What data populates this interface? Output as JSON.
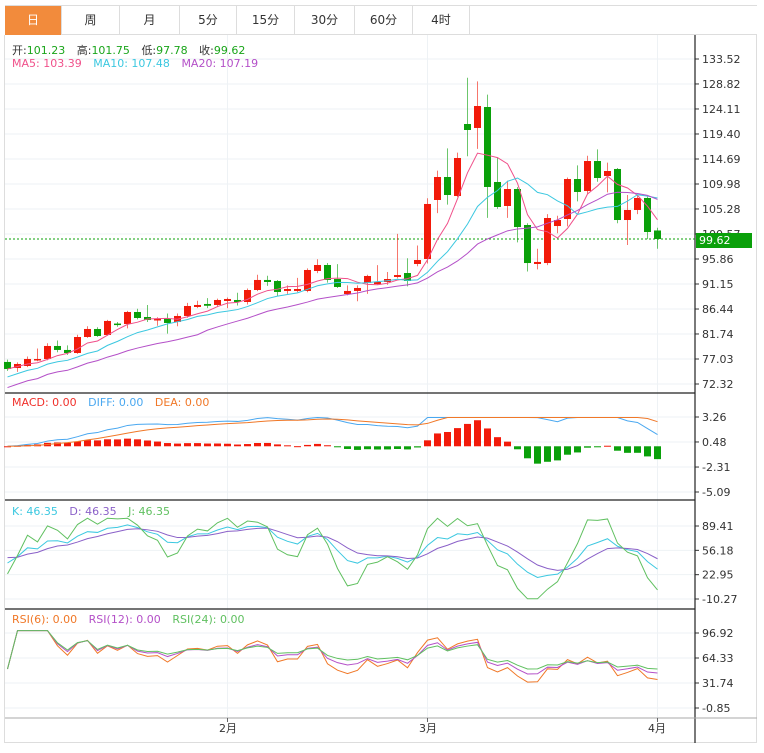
{
  "tabs": [
    {
      "label": "日",
      "active": true
    },
    {
      "label": "周"
    },
    {
      "label": "月"
    },
    {
      "label": "5分"
    },
    {
      "label": "15分"
    },
    {
      "label": "30分"
    },
    {
      "label": "60分"
    },
    {
      "label": "4时"
    }
  ],
  "quote": {
    "open_label": "开:",
    "open": "101.23",
    "high_label": "高:",
    "high": "101.75",
    "low_label": "低:",
    "low": "97.78",
    "close_label": "收:",
    "close": "99.62"
  },
  "ma": {
    "ma5": "MA5: 103.39",
    "ma10": "MA10: 107.48",
    "ma20": "MA20: 107.19"
  },
  "macd_legend": {
    "macd": "MACD: 0.00",
    "diff": "DIFF: 0.00",
    "dea": "DEA: 0.00"
  },
  "kdj_legend": {
    "k": "K: 46.35",
    "d": "D: 46.35",
    "j": "J: 46.35"
  },
  "rsi_legend": {
    "rsi6": "RSI(6): 0.00",
    "rsi12": "RSI(12): 0.00",
    "rsi24": "RSI(24): 0.00"
  },
  "last_price": "99.62",
  "colors": {
    "up": "#f21a0a",
    "down": "#0aa00a",
    "ma5": "#f0508a",
    "ma10": "#3cc8e0",
    "ma20": "#b450c8",
    "diff": "#4aa8f0",
    "dea": "#f07828",
    "accent": "#f28b3c"
  },
  "x_labels": [
    {
      "label": "2月",
      "index": 22
    },
    {
      "label": "3月",
      "index": 42
    },
    {
      "label": "4月",
      "index": 65
    }
  ],
  "chart_data": {
    "type": "candlestick",
    "price_axis": [
      "133.52",
      "128.82",
      "124.11",
      "119.40",
      "114.69",
      "109.98",
      "105.28",
      "100.57",
      "95.86",
      "91.15",
      "86.44",
      "81.74",
      "77.03",
      "72.32"
    ],
    "macd_axis": [
      "3.26",
      "0.48",
      "-2.31",
      "-5.09"
    ],
    "kdj_axis": [
      "89.41",
      "56.18",
      "22.95",
      "-10.27"
    ],
    "rsi_axis": [
      "96.92",
      "64.33",
      "31.74",
      "-0.85"
    ],
    "ohlc": [
      [
        76.47,
        76.9,
        74.8,
        75.15
      ],
      [
        75.33,
        76.4,
        74.6,
        76.09
      ],
      [
        75.71,
        77.5,
        75.5,
        77.03
      ],
      [
        76.95,
        79.0,
        76.6,
        77.03
      ],
      [
        77.03,
        80.0,
        76.8,
        79.48
      ],
      [
        79.48,
        80.5,
        78.3,
        78.73
      ],
      [
        78.73,
        79.6,
        77.8,
        78.16
      ],
      [
        78.16,
        81.6,
        78.0,
        81.17
      ],
      [
        81.17,
        83.2,
        81.0,
        82.68
      ],
      [
        82.68,
        83.0,
        81.2,
        81.36
      ],
      [
        81.55,
        84.4,
        81.4,
        84.19
      ],
      [
        83.7,
        84.0,
        83.1,
        83.62
      ],
      [
        83.62,
        86.1,
        82.8,
        85.88
      ],
      [
        85.88,
        86.5,
        84.5,
        84.75
      ],
      [
        84.94,
        87.2,
        84.0,
        84.37
      ],
      [
        84.37,
        84.9,
        83.3,
        84.56
      ],
      [
        84.56,
        85.6,
        81.8,
        83.81
      ],
      [
        84.0,
        85.6,
        83.2,
        85.13
      ],
      [
        85.13,
        87.6,
        84.8,
        87.01
      ],
      [
        86.82,
        88.0,
        86.6,
        87.2
      ],
      [
        87.39,
        88.5,
        86.6,
        87.05
      ],
      [
        87.2,
        88.4,
        86.8,
        88.14
      ],
      [
        87.95,
        88.6,
        86.6,
        88.33
      ],
      [
        88.14,
        89.5,
        87.1,
        87.76
      ],
      [
        87.76,
        90.3,
        87.3,
        90.02
      ],
      [
        90.02,
        92.9,
        89.8,
        91.91
      ],
      [
        91.91,
        92.7,
        90.8,
        91.53
      ],
      [
        91.72,
        91.9,
        88.8,
        89.65
      ],
      [
        89.84,
        90.9,
        89.3,
        90.21
      ],
      [
        89.84,
        92.3,
        89.6,
        90.21
      ],
      [
        89.84,
        94.1,
        89.6,
        93.79
      ],
      [
        93.6,
        95.8,
        93.2,
        94.73
      ],
      [
        94.73,
        95.1,
        91.4,
        91.91
      ],
      [
        92.09,
        94.9,
        90.4,
        90.59
      ],
      [
        89.27,
        90.9,
        89.0,
        89.84
      ],
      [
        89.84,
        90.9,
        87.9,
        90.4
      ],
      [
        91.34,
        92.9,
        89.3,
        92.66
      ],
      [
        91.15,
        94.7,
        91.0,
        91.53
      ],
      [
        91.53,
        93.4,
        91.0,
        92.09
      ],
      [
        92.47,
        100.6,
        92.2,
        92.84
      ],
      [
        93.22,
        96.0,
        90.7,
        91.72
      ],
      [
        94.92,
        98.4,
        94.5,
        95.67
      ],
      [
        95.86,
        107.3,
        95.0,
        106.22
      ],
      [
        106.97,
        112.5,
        104.5,
        111.3
      ],
      [
        111.3,
        116.7,
        106.1,
        107.91
      ],
      [
        107.72,
        115.9,
        107.5,
        114.88
      ],
      [
        121.28,
        130.0,
        115.2,
        120.15
      ],
      [
        120.53,
        129.3,
        116.6,
        124.67
      ],
      [
        124.48,
        126.8,
        103.6,
        109.42
      ],
      [
        110.36,
        115.0,
        105.3,
        105.65
      ],
      [
        105.84,
        110.6,
        103.6,
        109.04
      ],
      [
        109.04,
        109.4,
        99.0,
        101.88
      ],
      [
        102.26,
        102.6,
        93.5,
        95.1
      ],
      [
        94.92,
        97.8,
        93.9,
        95.3
      ],
      [
        95.1,
        104.3,
        94.7,
        103.58
      ],
      [
        102.07,
        104.0,
        100.7,
        103.2
      ],
      [
        103.39,
        111.2,
        102.0,
        110.92
      ],
      [
        110.92,
        113.5,
        106.7,
        108.48
      ],
      [
        108.67,
        115.3,
        108.0,
        114.31
      ],
      [
        114.31,
        116.5,
        110.4,
        111.11
      ],
      [
        111.49,
        114.0,
        108.4,
        112.43
      ],
      [
        112.81,
        113.0,
        102.6,
        103.2
      ],
      [
        103.2,
        107.9,
        98.5,
        105.09
      ],
      [
        105.09,
        108.0,
        104.3,
        107.35
      ],
      [
        107.35,
        107.6,
        99.6,
        100.94
      ],
      [
        101.23,
        101.75,
        97.78,
        99.62
      ]
    ]
  }
}
